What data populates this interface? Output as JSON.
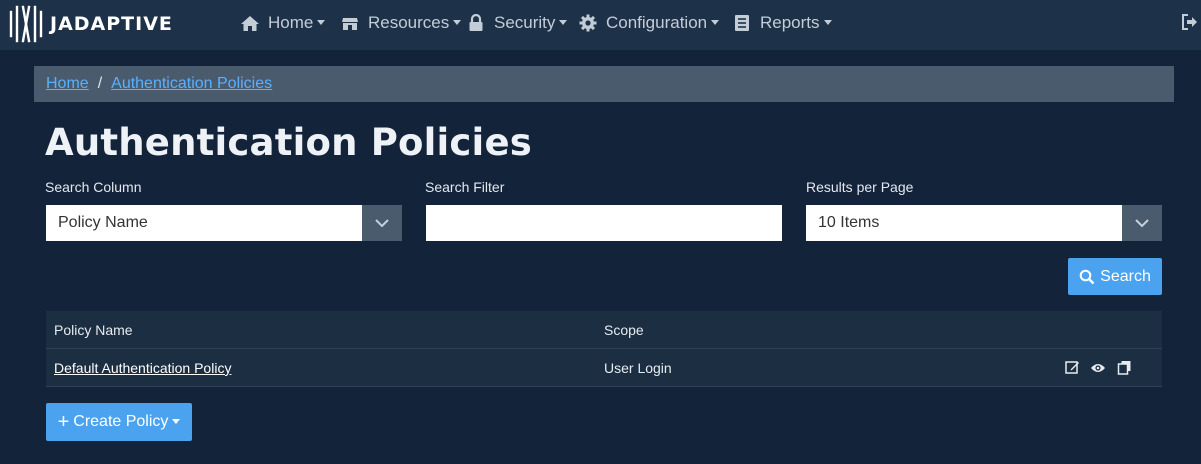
{
  "brand": {
    "name": "JADAPTIVE"
  },
  "nav": {
    "items": [
      {
        "label": "Home",
        "icon": "home-icon"
      },
      {
        "label": "Resources",
        "icon": "resources-icon"
      },
      {
        "label": "Security",
        "icon": "lock-icon"
      },
      {
        "label": "Configuration",
        "icon": "gear-icon"
      },
      {
        "label": "Reports",
        "icon": "reports-icon"
      }
    ],
    "logout_icon": "logout-icon"
  },
  "breadcrumb": {
    "items": [
      "Home",
      "Authentication Policies"
    ],
    "separator": "/"
  },
  "page": {
    "title": "Authentication Policies"
  },
  "filters": {
    "search_column": {
      "label": "Search Column",
      "value": "Policy Name"
    },
    "search_filter": {
      "label": "Search Filter",
      "value": "",
      "placeholder": ""
    },
    "results_per_page": {
      "label": "Results per Page",
      "value": "10 Items"
    },
    "search_button": "Search"
  },
  "table": {
    "columns": [
      "Policy Name",
      "Scope"
    ],
    "rows": [
      {
        "name": "Default Authentication Policy",
        "scope": "User Login",
        "actions": [
          "edit-icon",
          "view-icon",
          "copy-icon"
        ]
      }
    ]
  },
  "create_button": "Create Policy",
  "colors": {
    "accent": "#4ba2ee",
    "navbar": "#1d3249",
    "background": "#12233a",
    "link": "#5ab0ff"
  }
}
